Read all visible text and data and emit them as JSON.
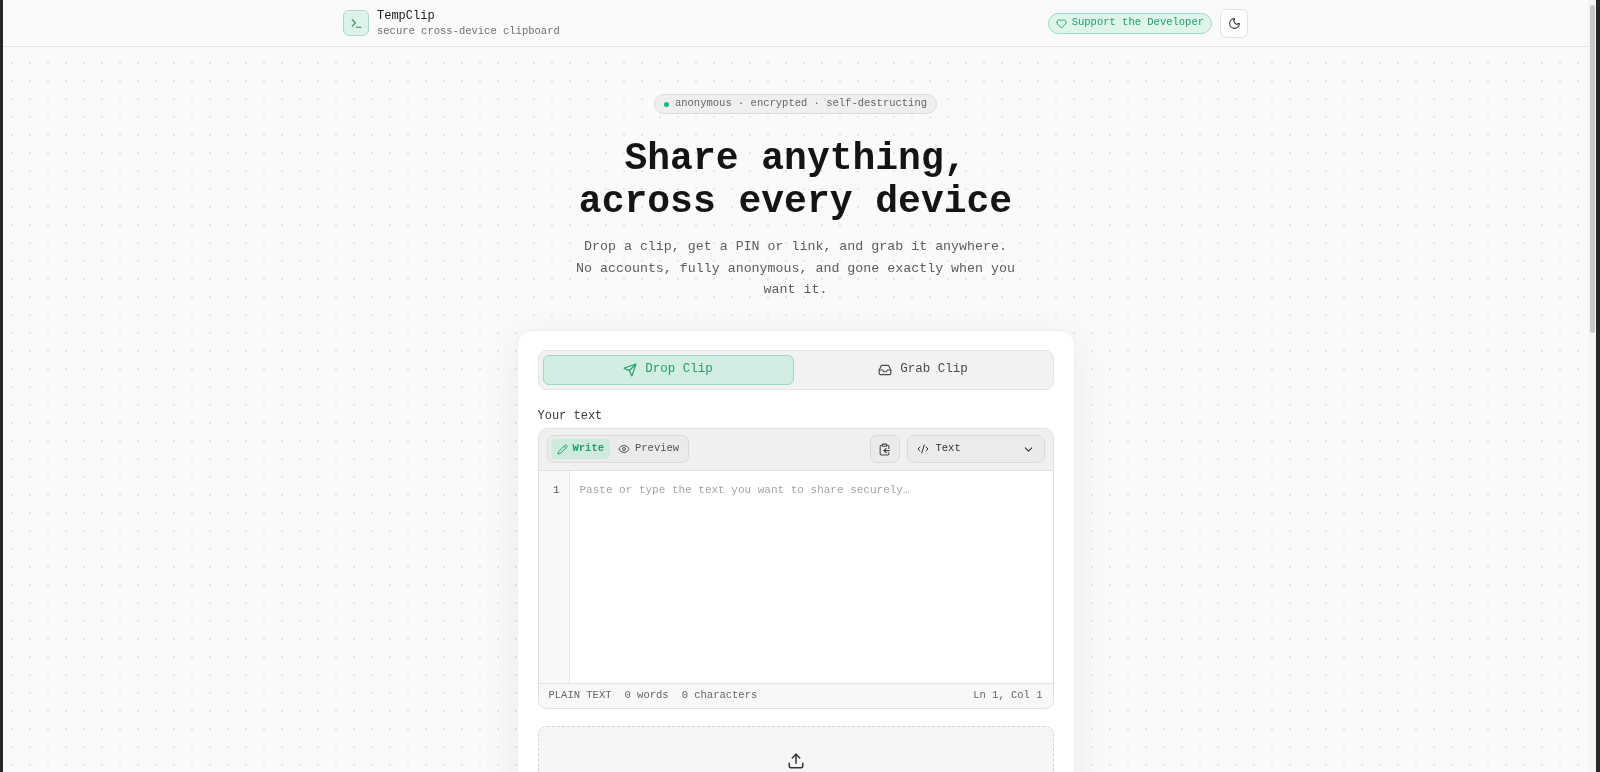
{
  "header": {
    "title": "TempClip",
    "subtitle": "secure cross-device clipboard",
    "support_button": "Support the Developer"
  },
  "hero": {
    "badge": "anonymous · encrypted · self-destructing",
    "heading": "Share anything, across every device",
    "description": "Drop a clip, get a PIN or link, and grab it anywhere. No accounts, fully anonymous, and gone exactly when you want it."
  },
  "mode_tabs": [
    {
      "label": "Drop Clip",
      "selected": true
    },
    {
      "label": "Grab Clip",
      "selected": false
    }
  ],
  "editor": {
    "label": "Your text",
    "view_tabs": [
      {
        "label": "Write",
        "selected": true
      },
      {
        "label": "Preview",
        "selected": false
      }
    ],
    "format_select": {
      "value": "Text"
    },
    "line_numbers": [
      "1"
    ],
    "placeholder": "Paste or type the text you want to share securely…",
    "status_bar": {
      "mode": "PLAIN TEXT",
      "words": "0 words",
      "characters": "0 characters",
      "cursor": "Ln 1, Col 1"
    }
  }
}
